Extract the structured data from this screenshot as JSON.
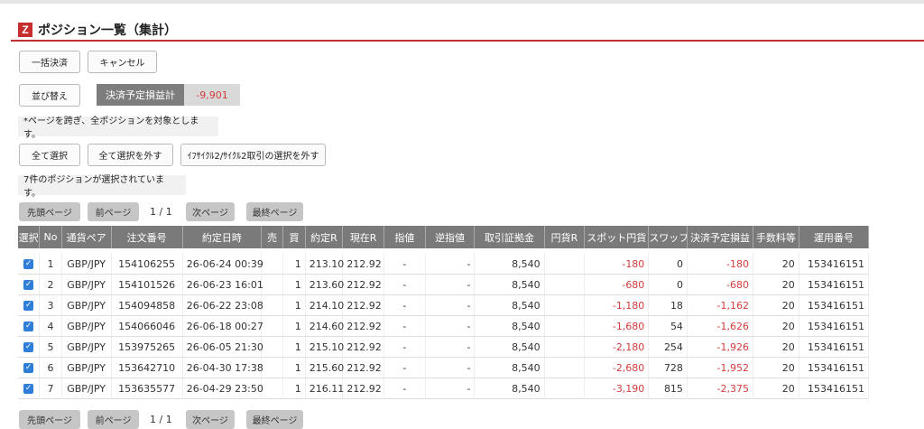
{
  "header": {
    "logo": "Z",
    "title": "ポジション一覧（集計）"
  },
  "buttons": {
    "bulk_settle": "一括決済",
    "cancel": "キャンセル",
    "sort": "並び替え",
    "select_all": "全て選択",
    "deselect_all": "全て選択を外す",
    "deselect_cycle": "ｲﾌｻｲｸﾙ2/ｻｲｸﾙ2取引の選択を外す"
  },
  "pl_summary": {
    "label": "決済予定損益計",
    "value": "-9,901"
  },
  "notes": {
    "cross_page": "*ページを跨ぎ、全ポジションを対象とします。",
    "selected_count": "7件のポジションが選択されています。"
  },
  "pagination": {
    "first": "先頭ページ",
    "prev": "前ページ",
    "info": "1 / 1",
    "next": "次ページ",
    "last": "最終ページ"
  },
  "table": {
    "headers": [
      "選択",
      "No",
      "通貨ペア",
      "注文番号",
      "約定日時",
      "売",
      "買",
      "約定R",
      "現在R",
      "指値",
      "逆指値",
      "取引証拠金",
      "円貨R",
      "スポット円貨",
      "スワップ",
      "決済予定損益",
      "手数料等",
      "運用番号"
    ],
    "rows": [
      {
        "no": "1",
        "pair": "GBP/JPY",
        "order": "154106255",
        "time": "26-06-24 00:39",
        "sell": "",
        "buy": "1",
        "exec": "213.10",
        "current": "212.92",
        "limit": "-",
        "stop": "-",
        "margin": "8,540",
        "yen": "",
        "spot": "-180",
        "swap": "0",
        "pl": "-180",
        "fee": "20",
        "op": "153416151"
      },
      {
        "no": "2",
        "pair": "GBP/JPY",
        "order": "154101526",
        "time": "26-06-23 16:01",
        "sell": "",
        "buy": "1",
        "exec": "213.60",
        "current": "212.92",
        "limit": "-",
        "stop": "-",
        "margin": "8,540",
        "yen": "",
        "spot": "-680",
        "swap": "0",
        "pl": "-680",
        "fee": "20",
        "op": "153416151"
      },
      {
        "no": "3",
        "pair": "GBP/JPY",
        "order": "154094858",
        "time": "26-06-22 23:08",
        "sell": "",
        "buy": "1",
        "exec": "214.10",
        "current": "212.92",
        "limit": "-",
        "stop": "-",
        "margin": "8,540",
        "yen": "",
        "spot": "-1,180",
        "swap": "18",
        "pl": "-1,162",
        "fee": "20",
        "op": "153416151"
      },
      {
        "no": "4",
        "pair": "GBP/JPY",
        "order": "154066046",
        "time": "26-06-18 00:27",
        "sell": "",
        "buy": "1",
        "exec": "214.60",
        "current": "212.92",
        "limit": "-",
        "stop": "-",
        "margin": "8,540",
        "yen": "",
        "spot": "-1,680",
        "swap": "54",
        "pl": "-1,626",
        "fee": "20",
        "op": "153416151"
      },
      {
        "no": "5",
        "pair": "GBP/JPY",
        "order": "153975265",
        "time": "26-06-05 21:30",
        "sell": "",
        "buy": "1",
        "exec": "215.10",
        "current": "212.92",
        "limit": "-",
        "stop": "-",
        "margin": "8,540",
        "yen": "",
        "spot": "-2,180",
        "swap": "254",
        "pl": "-1,926",
        "fee": "20",
        "op": "153416151"
      },
      {
        "no": "6",
        "pair": "GBP/JPY",
        "order": "153642710",
        "time": "26-04-30 17:38",
        "sell": "",
        "buy": "1",
        "exec": "215.60",
        "current": "212.92",
        "limit": "-",
        "stop": "-",
        "margin": "8,540",
        "yen": "",
        "spot": "-2,680",
        "swap": "728",
        "pl": "-1,952",
        "fee": "20",
        "op": "153416151"
      },
      {
        "no": "7",
        "pair": "GBP/JPY",
        "order": "153635577",
        "time": "26-04-29 23:50",
        "sell": "",
        "buy": "1",
        "exec": "216.11",
        "current": "212.92",
        "limit": "-",
        "stop": "-",
        "margin": "8,540",
        "yen": "",
        "spot": "-3,190",
        "swap": "815",
        "pl": "-2,375",
        "fee": "20",
        "op": "153416151"
      }
    ]
  },
  "colors": {
    "accent_red": "#c03030",
    "negative": "#d23c3c",
    "header_gray": "#7a7a7a",
    "checkbox": "#2f7fd8"
  }
}
